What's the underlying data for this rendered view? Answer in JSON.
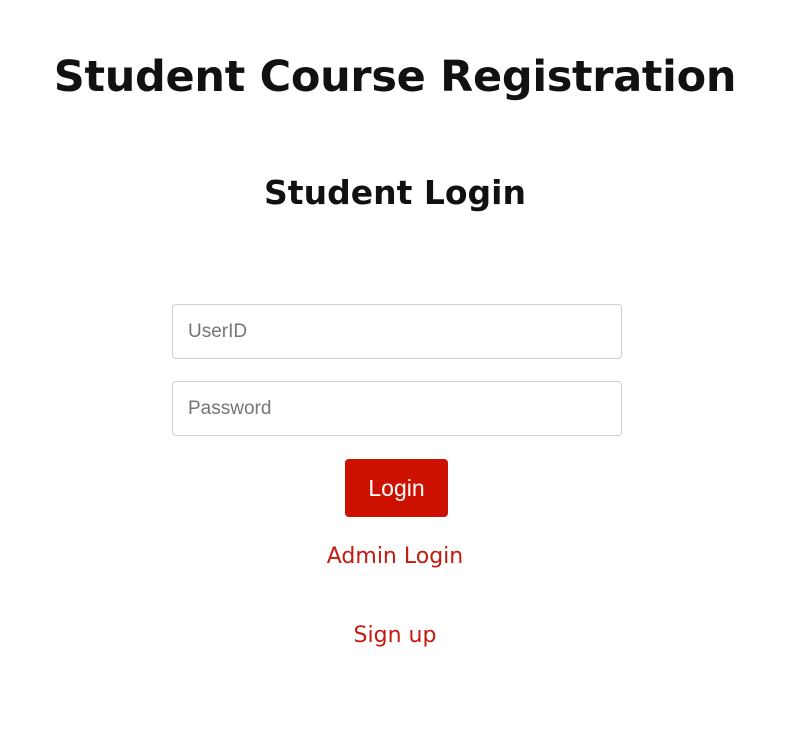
{
  "header": {
    "title": "Student Course Registration"
  },
  "login_form": {
    "heading": "Student Login",
    "userid_placeholder": "UserID",
    "password_placeholder": "Password",
    "submit_label": "Login"
  },
  "links": {
    "admin_login": "Admin Login",
    "sign_up": "Sign up"
  },
  "colors": {
    "accent": "#cc1100",
    "link": "#c31a12"
  }
}
